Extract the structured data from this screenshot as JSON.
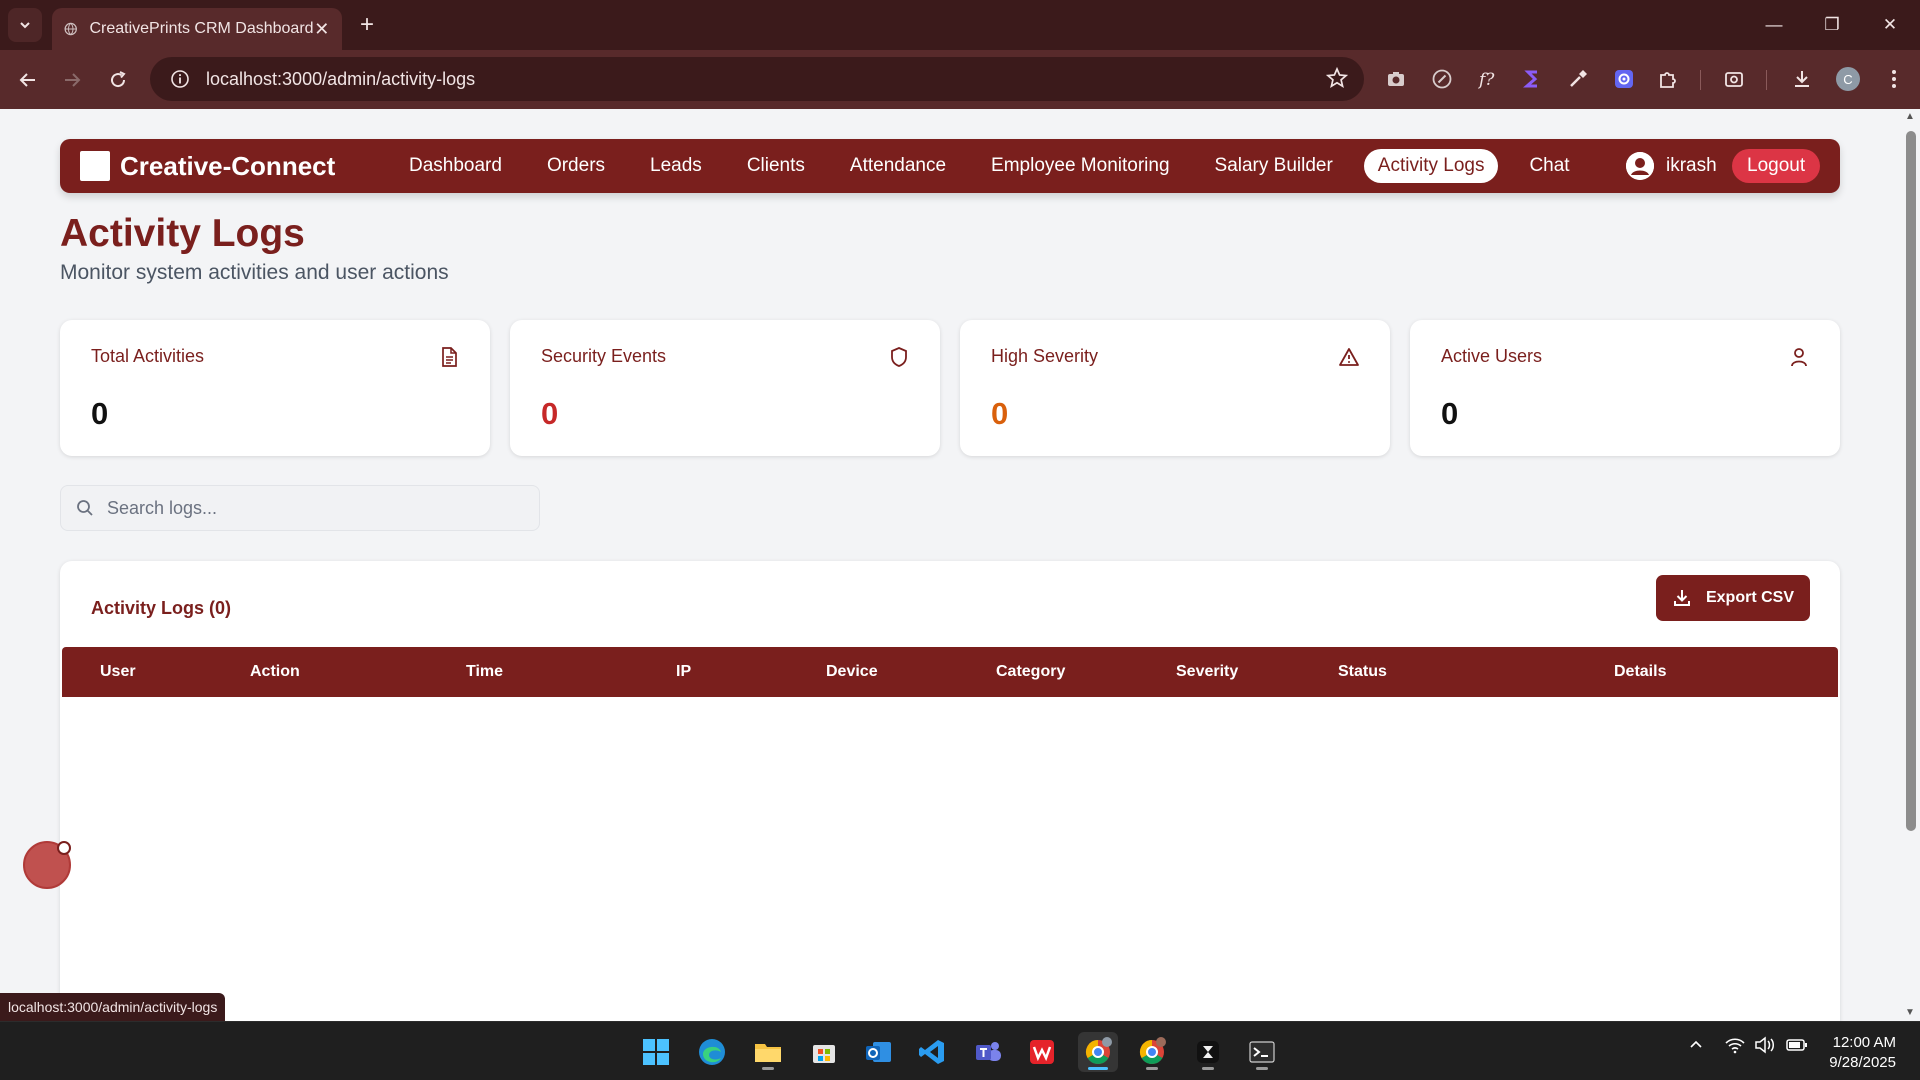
{
  "browser": {
    "tab_title": "CreativePrints CRM Dashboard",
    "tab_close": "✕",
    "new_tab": "+",
    "url": "localhost:3000/admin/activity-logs",
    "minimize": "—",
    "restore": "❐",
    "close": "✕",
    "profile_initial": "C",
    "status_url": "localhost:3000/admin/activity-logs"
  },
  "app": {
    "brand": "Creative-Connect",
    "nav": [
      {
        "label": "Dashboard",
        "active": false
      },
      {
        "label": "Orders",
        "active": false
      },
      {
        "label": "Leads",
        "active": false
      },
      {
        "label": "Clients",
        "active": false
      },
      {
        "label": "Attendance",
        "active": false
      },
      {
        "label": "Employee Monitoring",
        "active": false
      },
      {
        "label": "Salary Builder",
        "active": false
      },
      {
        "label": "Activity Logs",
        "active": true
      },
      {
        "label": "Chat",
        "active": false
      }
    ],
    "user": "ikrash",
    "logout": "Logout",
    "accent": "#7a1f1d",
    "danger": "#dc3545"
  },
  "page": {
    "title": "Activity Logs",
    "subtitle": "Monitor system activities and user actions"
  },
  "stats": [
    {
      "label": "Total Activities",
      "value": "0",
      "icon": "document-icon",
      "color": "#111111"
    },
    {
      "label": "Security Events",
      "value": "0",
      "icon": "shield-icon",
      "color": "#c62828"
    },
    {
      "label": "High Severity",
      "value": "0",
      "icon": "warning-icon",
      "color": "#d9600c"
    },
    {
      "label": "Active Users",
      "value": "0",
      "icon": "user-icon",
      "color": "#111111"
    }
  ],
  "search": {
    "placeholder": "Search logs...",
    "value": ""
  },
  "logs": {
    "title": "Activity Logs (0)",
    "export_label": "Export CSV",
    "columns": [
      "User",
      "Action",
      "Time",
      "IP",
      "Device",
      "Category",
      "Severity",
      "Status",
      "Details"
    ],
    "rows": []
  },
  "taskbar": {
    "apps": [
      "windows-start",
      "edge",
      "file-explorer",
      "microsoft-store",
      "outlook",
      "vscode",
      "teams",
      "wps-office",
      "chrome-profile-c",
      "chrome-profile-a",
      "app-terminal-dark",
      "terminal"
    ],
    "time": "12:00 AM",
    "date": "9/28/2025"
  }
}
